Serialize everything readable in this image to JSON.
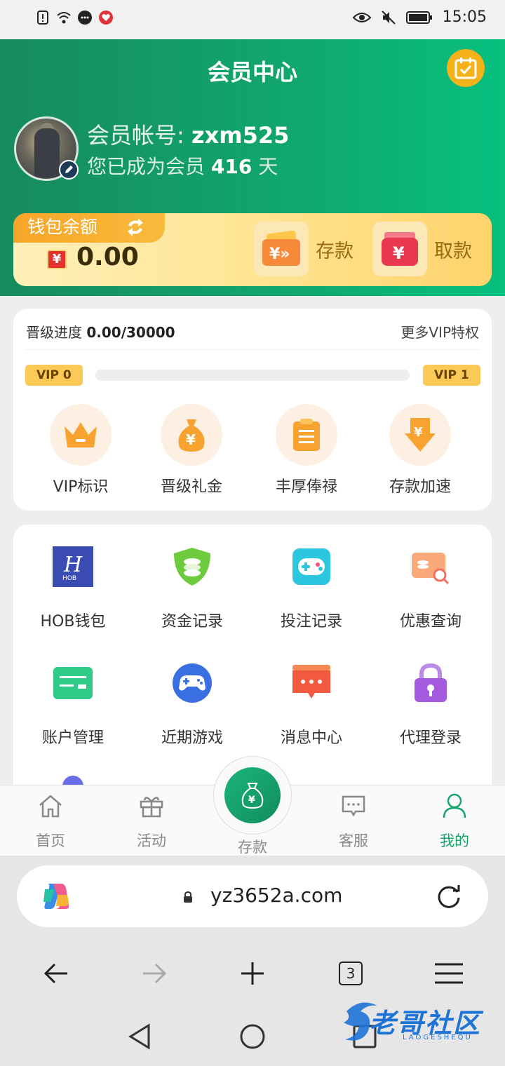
{
  "status_bar": {
    "time": "15:05",
    "left_icons": [
      "alert-icon",
      "wifi-icon",
      "chat-icon",
      "heart-app-icon"
    ],
    "right_icons": [
      "eye-icon",
      "mute-icon",
      "battery-icon"
    ]
  },
  "header": {
    "title": "会员中心",
    "account_label": "会员帐号:",
    "account_value": "zxm525",
    "days_prefix": "您已成为会员",
    "days_value": "416",
    "days_suffix": "天"
  },
  "wallet": {
    "tab_label": "钱包余额",
    "currency_symbol": "¥",
    "balance": "0.00",
    "deposit_label": "存款",
    "withdraw_label": "取款"
  },
  "vip": {
    "progress_label": "晋级进度",
    "progress_value": "0.00/30000",
    "progress_fraction": 0.0,
    "more_label": "更多VIP特权",
    "current_level": "VIP 0",
    "next_level": "VIP 1",
    "items": [
      {
        "label": "VIP标识",
        "icon": "crown-icon"
      },
      {
        "label": "晋级礼金",
        "icon": "money-bag-icon"
      },
      {
        "label": "丰厚俸禄",
        "icon": "clipboard-icon"
      },
      {
        "label": "存款加速",
        "icon": "deposit-arrow-icon"
      }
    ]
  },
  "menu": {
    "items": [
      {
        "label": "HOB钱包",
        "icon": "hob-wallet-icon",
        "logo_text": "HOB"
      },
      {
        "label": "资金记录",
        "icon": "shield-coins-icon"
      },
      {
        "label": "投注记录",
        "icon": "gamepad-icon"
      },
      {
        "label": "优惠查询",
        "icon": "coupon-search-icon"
      },
      {
        "label": "账户管理",
        "icon": "card-icon"
      },
      {
        "label": "近期游戏",
        "icon": "controller-icon"
      },
      {
        "label": "消息中心",
        "icon": "message-icon"
      },
      {
        "label": "代理登录",
        "icon": "lock-icon"
      }
    ]
  },
  "tabbar": {
    "items": [
      {
        "label": "首页",
        "icon": "home-icon"
      },
      {
        "label": "活动",
        "icon": "gift-icon"
      },
      {
        "label": "存款",
        "icon": "money-bag-icon"
      },
      {
        "label": "客服",
        "icon": "chat-bubble-icon"
      },
      {
        "label": "我的",
        "icon": "person-icon"
      }
    ],
    "active": "我的"
  },
  "browser": {
    "url": "yz3652a.com",
    "tab_count": "3"
  },
  "watermark": {
    "text": "老哥社区",
    "subtext": "LAOGESHEQU"
  },
  "colors": {
    "primary_green": "#10a86f",
    "accent_gold": "#fbc956",
    "active_tab": "#18a56d"
  }
}
